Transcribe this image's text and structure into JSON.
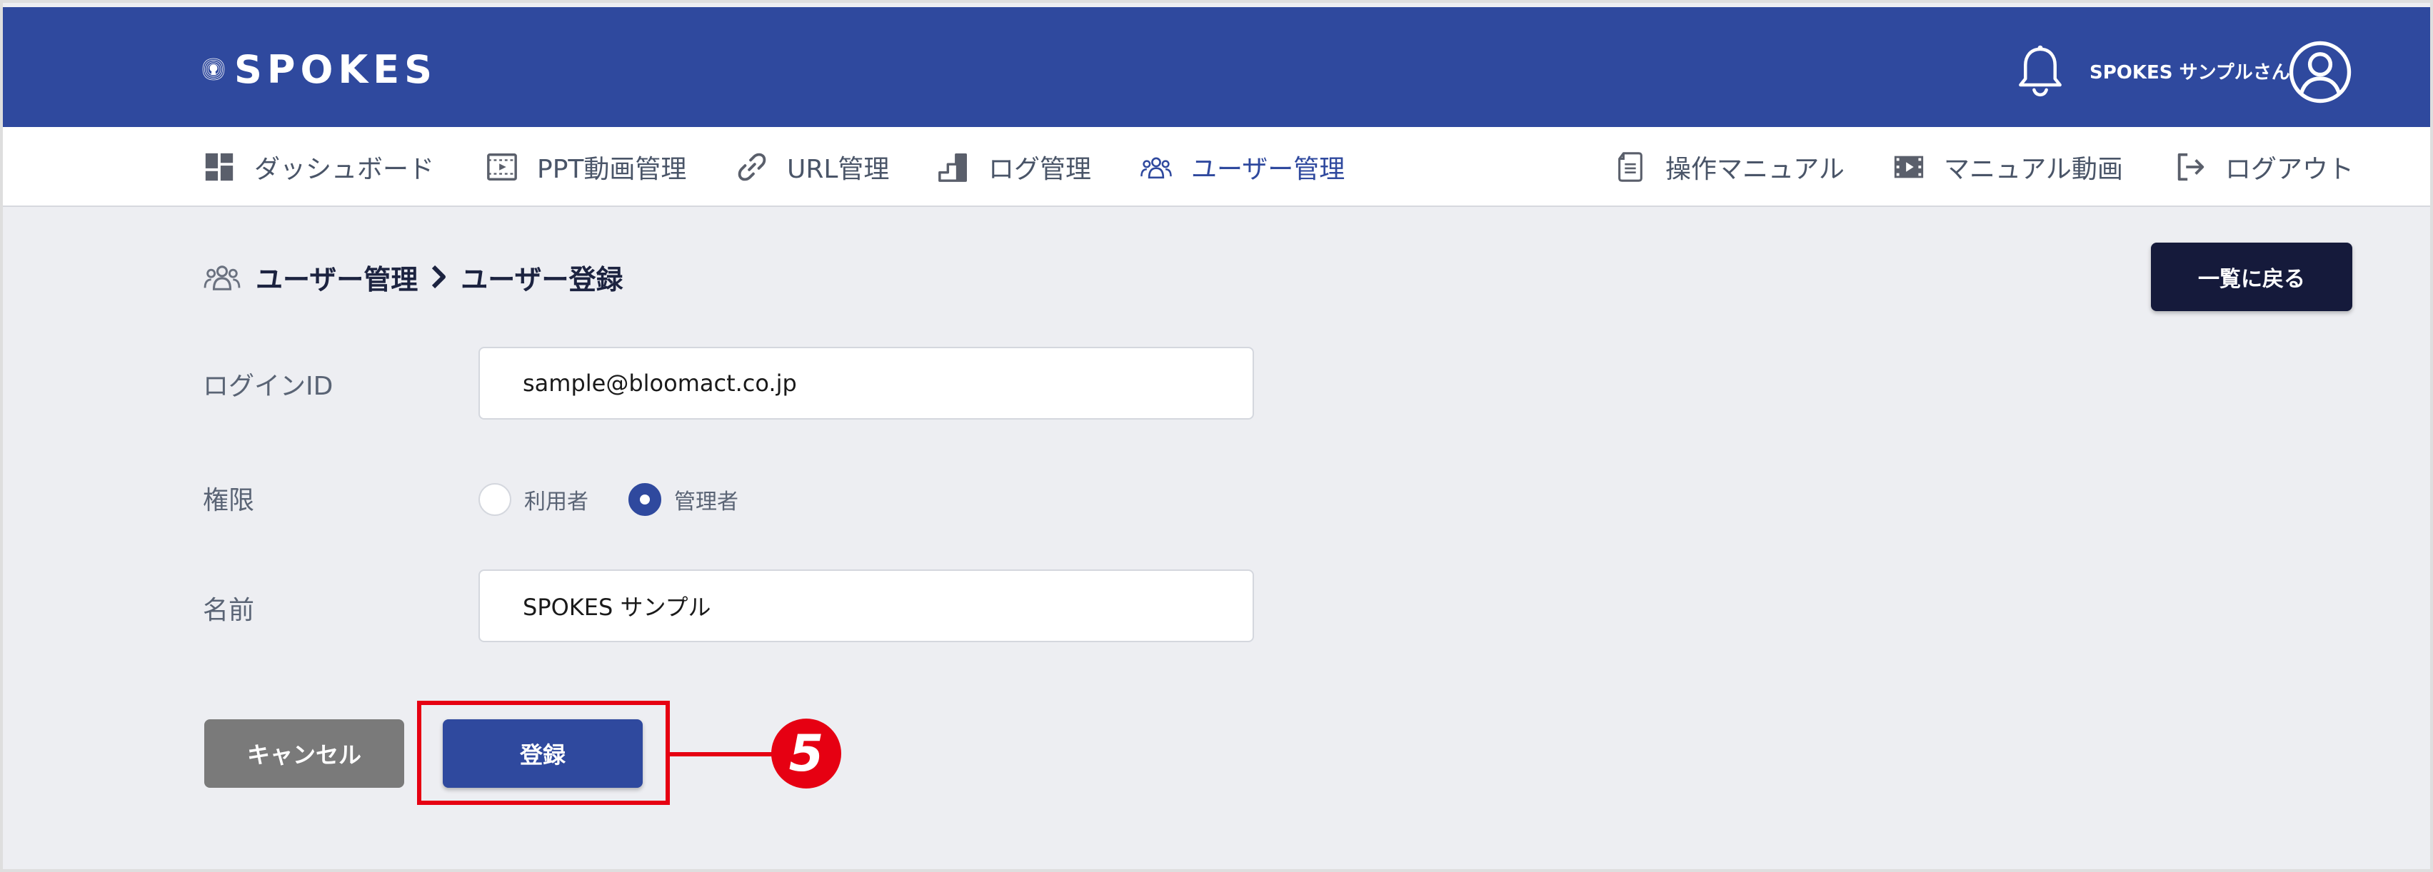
{
  "header": {
    "logo_text": "SPOKES",
    "user_name": "SPOKES サンプルさん"
  },
  "nav": {
    "left": [
      {
        "label": "ダッシュボード",
        "icon": "dashboard-icon"
      },
      {
        "label": "PPT動画管理",
        "icon": "ppt-video-icon"
      },
      {
        "label": "URL管理",
        "icon": "link-icon"
      },
      {
        "label": "ログ管理",
        "icon": "log-steps-icon"
      },
      {
        "label": "ユーザー管理",
        "icon": "users-icon",
        "active": true
      }
    ],
    "right": [
      {
        "label": "操作マニュアル",
        "icon": "document-icon"
      },
      {
        "label": "マニュアル動画",
        "icon": "film-icon"
      },
      {
        "label": "ログアウト",
        "icon": "logout-icon"
      }
    ]
  },
  "breadcrumb": {
    "parent": "ユーザー管理",
    "current": "ユーザー登録"
  },
  "back_button": "一覧に戻る",
  "form": {
    "login_id": {
      "label": "ログインID",
      "value": "sample@bloomact.co.jp"
    },
    "role": {
      "label": "権限",
      "options": [
        "利用者",
        "管理者"
      ],
      "selected": "管理者"
    },
    "name": {
      "label": "名前",
      "value": "SPOKES サンプル"
    }
  },
  "actions": {
    "cancel": "キャンセル",
    "submit": "登録"
  },
  "annotation": {
    "step_number": "5",
    "color": "#e60012"
  },
  "colors": {
    "brand": "#2f499e",
    "dark_button": "#151a3b",
    "cancel_button": "#7a7a7a",
    "background": "#edeef2"
  }
}
